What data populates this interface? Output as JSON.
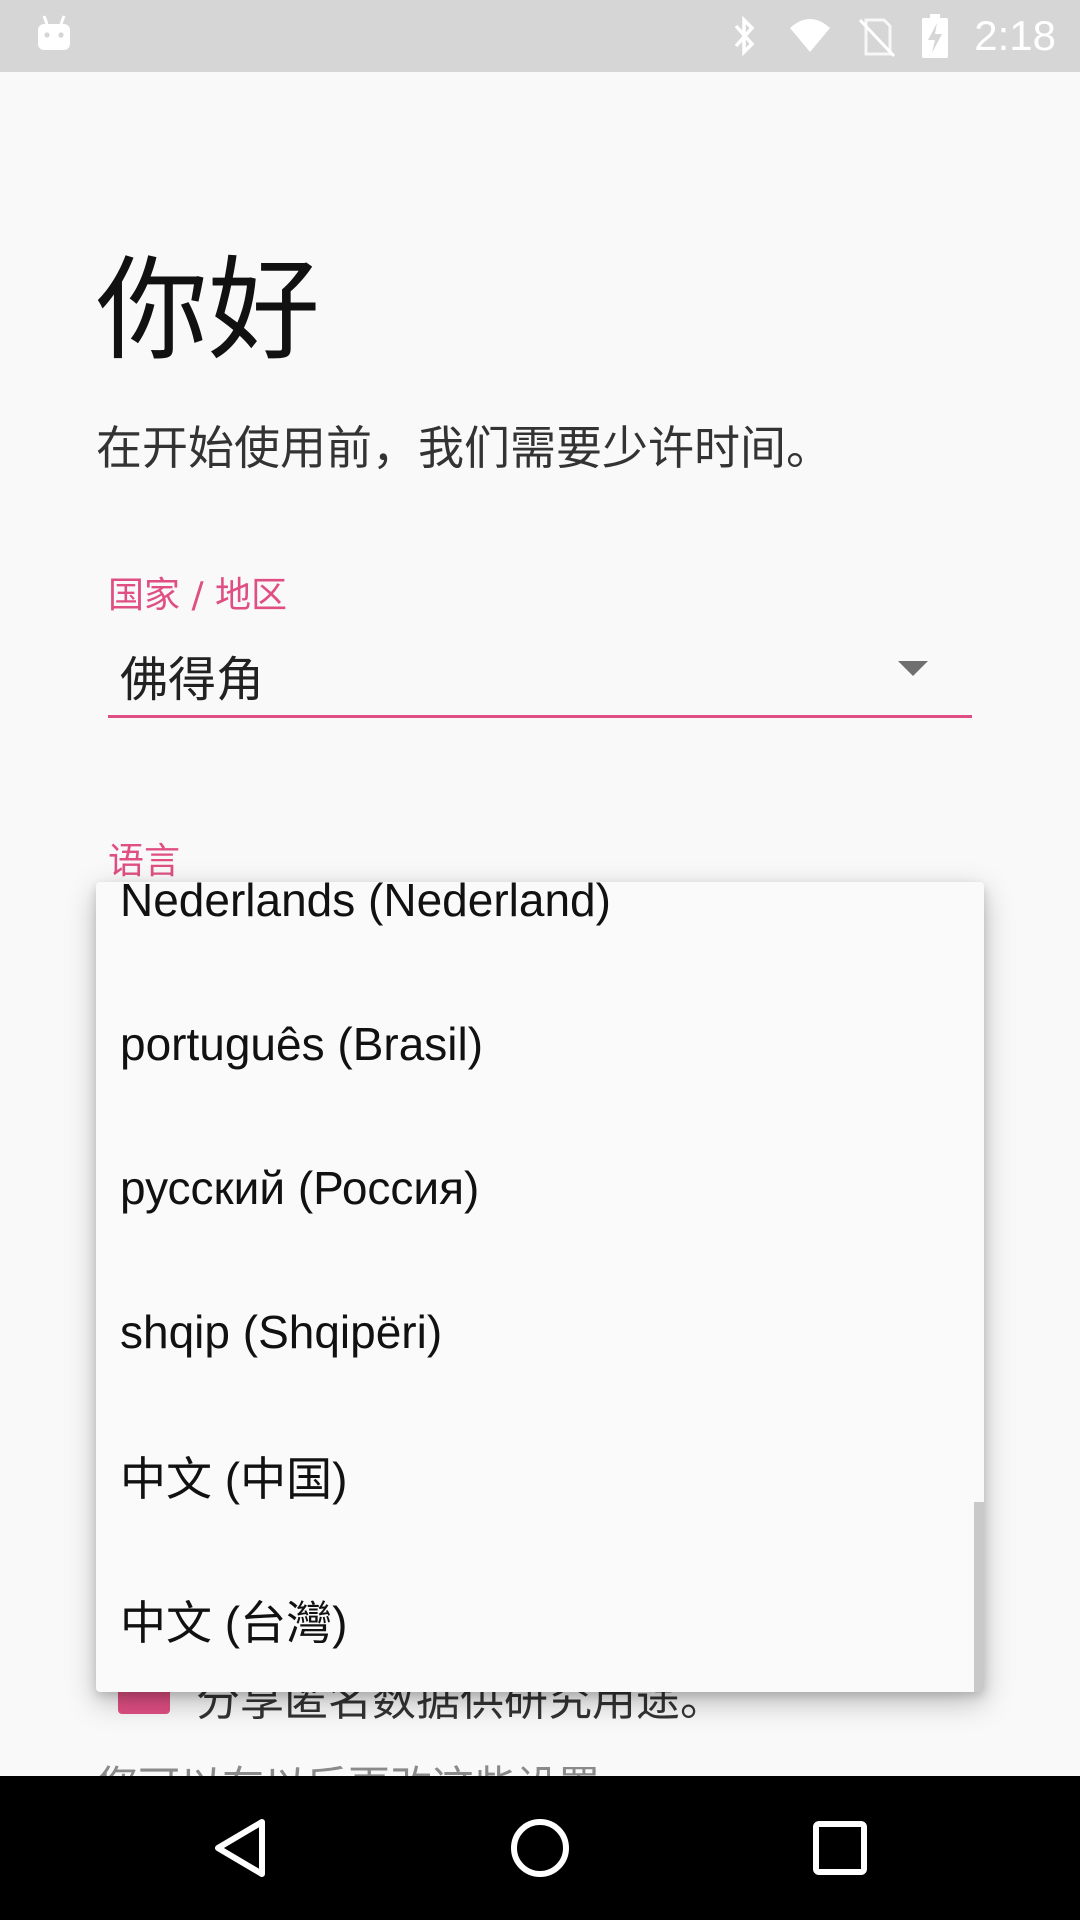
{
  "status_bar": {
    "time": "2:18",
    "icons": [
      "android-icon",
      "bluetooth-icon",
      "wifi-icon",
      "no-sim-icon",
      "battery-charging-icon"
    ]
  },
  "setup": {
    "title": "你好",
    "subtitle": "在开始使用前，我们需要少许时间。",
    "country_label": "国家 / 地区",
    "country_value": "佛得角",
    "language_label": "语言",
    "checkbox_label": "分享匿名数据供研究用途。",
    "footnote": "您可以在以后更改这些设置。"
  },
  "language_dropdown": {
    "items": [
      "Nederlands (Nederland)",
      "português (Brasil)",
      "русский (Россия)",
      "shqip (Shqipëri)",
      "中文 (中国)",
      "中文 (台灣)"
    ]
  },
  "nav_bar": {
    "buttons": [
      "back",
      "home",
      "recents"
    ]
  },
  "colors": {
    "accent": "#e04f83",
    "status_bar": "#d6d6d6",
    "background": "#f9f9f9",
    "nav_bar": "#000000"
  }
}
